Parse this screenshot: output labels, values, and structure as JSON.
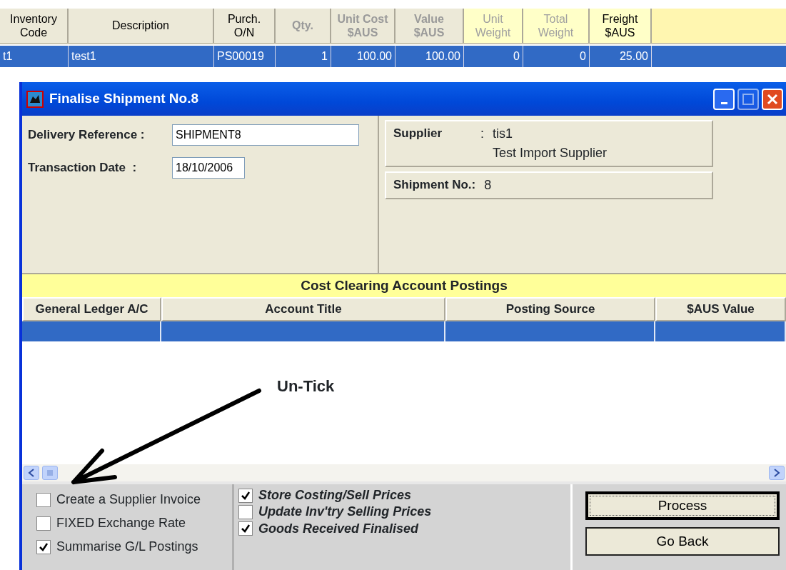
{
  "grid": {
    "columns": [
      {
        "label": "Inventory\nCode",
        "kind": "plain"
      },
      {
        "label": "Description",
        "kind": "plain"
      },
      {
        "label": "Purch.\nO/N",
        "kind": "plain"
      },
      {
        "label": "Qty.",
        "kind": "dim_bold"
      },
      {
        "label": "Unit Cost\n$AUS",
        "kind": "dim_bold"
      },
      {
        "label": "Value\n$AUS",
        "kind": "dim_bold"
      },
      {
        "label": "Unit\nWeight",
        "kind": "dim_yellow"
      },
      {
        "label": "Total\nWeight",
        "kind": "dim_yellow"
      },
      {
        "label": "Freight\n$AUS",
        "kind": "yellow"
      }
    ],
    "rows": [
      {
        "selected": true,
        "cells": [
          "t1",
          "test1",
          "PS00019",
          "1",
          "100.00",
          "100.00",
          "0",
          "0",
          "25.00"
        ]
      }
    ]
  },
  "dialog": {
    "title": "Finalise Shipment No.8",
    "fields": [
      {
        "label": "Delivery Reference :",
        "value": "SHIPMENT8"
      },
      {
        "label": "Transaction Date  :",
        "value": "18/10/2006"
      }
    ],
    "supplier": {
      "label": "Supplier",
      "separator": ":",
      "code": "tis1",
      "name": "Test Import Supplier"
    },
    "shipment": {
      "label": "Shipment No.:",
      "value": "8"
    },
    "postings": {
      "title": "Cost Clearing Account Postings",
      "columns": [
        "General Ledger A/C",
        "Account Title",
        "Posting Source",
        "$AUS Value"
      ],
      "blank_row": {
        "selected": true
      }
    },
    "options": [
      {
        "label": "Create a Supplier Invoice",
        "checked": false
      },
      {
        "label": "FIXED Exchange Rate",
        "checked": false
      },
      {
        "label": "Summarise G/L Postings",
        "checked": true
      }
    ],
    "finalise_options": [
      {
        "label": "Store Costing/Sell Prices",
        "checked": true
      },
      {
        "label": "Update Inv'try Selling Prices",
        "checked": false
      },
      {
        "label": "Goods Received Finalised",
        "checked": true
      }
    ],
    "buttons": [
      {
        "label": "Process",
        "default": true
      },
      {
        "label": "Go Back",
        "default": false
      }
    ]
  },
  "annotation": {
    "text": "Un-Tick"
  }
}
